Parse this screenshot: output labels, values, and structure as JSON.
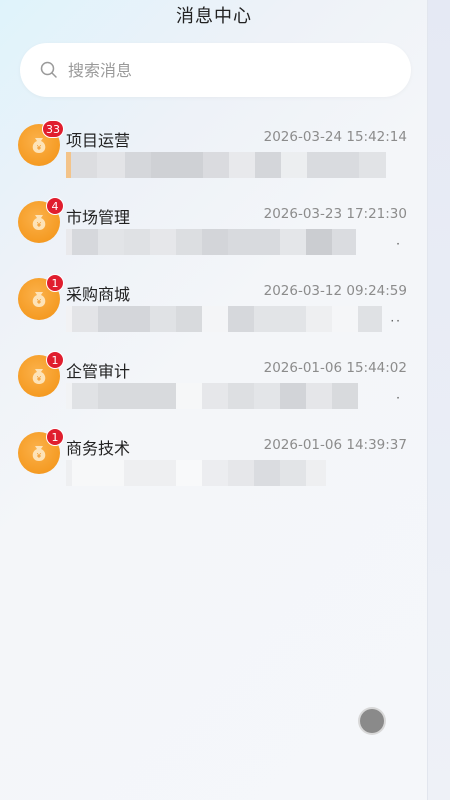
{
  "header": {
    "title": "消息中心"
  },
  "search": {
    "placeholder": "搜索消息"
  },
  "messages": [
    {
      "name": "项目运营",
      "badge": "33",
      "time": "2026-03-24 15:42:14",
      "dots": ""
    },
    {
      "name": "市场管理",
      "badge": "4",
      "time": "2026-03-23 17:21:30",
      "dots": "·"
    },
    {
      "name": "采购商城",
      "badge": "1",
      "time": "2026-03-12 09:24:59",
      "dots": "··"
    },
    {
      "name": "企管审计",
      "badge": "1",
      "time": "2026-01-06 15:44:02",
      "dots": "·"
    },
    {
      "name": "商务技术",
      "badge": "1",
      "time": "2026-01-06 14:39:37",
      "dots": ""
    }
  ],
  "icons": {
    "search": "search-icon",
    "avatar": "money-bag-icon",
    "floating": "floating-assistant-icon"
  },
  "colors": {
    "avatar": "#f59b23",
    "badge": "#e01e2e",
    "accent_bar": "#f3a347"
  }
}
